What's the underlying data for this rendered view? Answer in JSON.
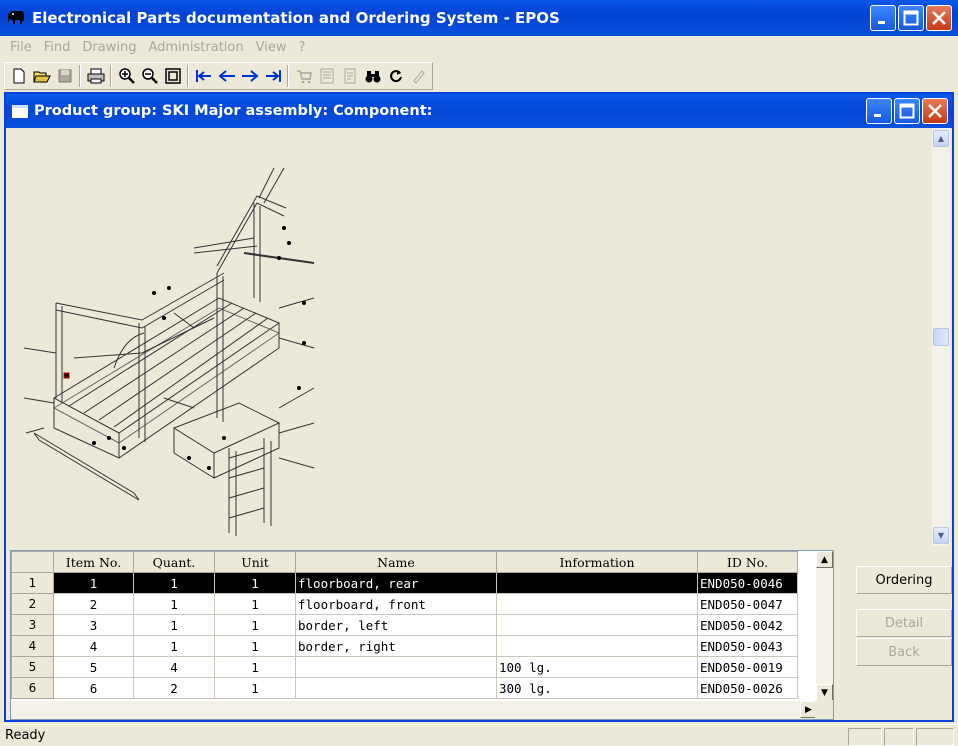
{
  "window": {
    "title": "Electronical Parts documentation and Ordering System - EPOS"
  },
  "menu": [
    "File",
    "Find",
    "Drawing",
    "Administration",
    "View",
    "?"
  ],
  "toolbar": {
    "groups": [
      [
        "new-document-icon",
        "open-folder-icon",
        "save-disk-icon"
      ],
      [
        "print-icon"
      ],
      [
        "zoom-in-icon",
        "zoom-out-icon",
        "zoom-fit-icon"
      ],
      [
        "first-record-icon",
        "previous-record-icon",
        "next-record-icon",
        "last-record-icon"
      ],
      [
        "shopping-cart-icon",
        "document-list-icon",
        "document-icon",
        "binoculars-icon",
        "refresh-icon",
        "pencil-icon"
      ]
    ]
  },
  "child_window": {
    "title": "Product group: SKI  Major assembly:  Component:"
  },
  "drawing": {
    "icon": "assembly-drawing"
  },
  "grid": {
    "columns": [
      "Item No.",
      "Quant.",
      "Unit",
      "Name",
      "Information",
      "ID No."
    ],
    "rows": [
      {
        "row": "1",
        "item": "1",
        "quant": "1",
        "unit": "1",
        "name": "floorboard, rear",
        "info": "",
        "id": "END050-0046"
      },
      {
        "row": "2",
        "item": "2",
        "quant": "1",
        "unit": "1",
        "name": "floorboard, front",
        "info": "",
        "id": "END050-0047"
      },
      {
        "row": "3",
        "item": "3",
        "quant": "1",
        "unit": "1",
        "name": "border, left",
        "info": "",
        "id": "END050-0042"
      },
      {
        "row": "4",
        "item": "4",
        "quant": "1",
        "unit": "1",
        "name": "border, right",
        "info": "",
        "id": "END050-0043"
      },
      {
        "row": "5",
        "item": "5",
        "quant": "4",
        "unit": "1",
        "name": "",
        "info": "100 lg.",
        "id": "END050-0019"
      },
      {
        "row": "6",
        "item": "6",
        "quant": "2",
        "unit": "1",
        "name": "",
        "info": "300 lg.",
        "id": "END050-0026"
      }
    ]
  },
  "buttons": {
    "ordering": "Ordering",
    "detail": "Detail",
    "back": "Back"
  },
  "status": {
    "text": "Ready"
  },
  "colors": {
    "title_blue": "#0842d8",
    "selection": "#000000",
    "face": "#ece9d8"
  }
}
